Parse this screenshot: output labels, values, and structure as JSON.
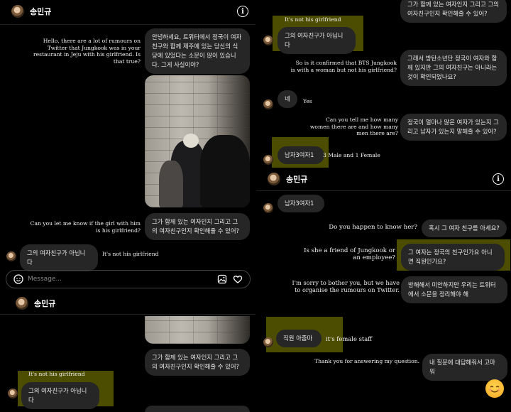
{
  "header": {
    "username": "송민규"
  },
  "left_panel": {
    "messages": [
      {
        "speaker": "sent",
        "korean": "안녕하세요, 트위터에서 정국이 여자친구와 함께 제주에 있는 당신의 식당에 있었다는 소문이 많이 있습니다. 그게 사실이야?",
        "english": "Hello, there are a lot of rumours on Twitter that Jungkook was in your restaurant in Jeju with his girlfriend. Is that true?"
      },
      {
        "speaker": "sent",
        "korean": "그가 함께 있는 여자인지 그리고 그의 여자친구인지 확인해줄 수 있어?",
        "english": "Can you let me know if the girl with him is his girlfriend?"
      },
      {
        "speaker": "received",
        "korean": "그의 여자친구가 아닙니다",
        "english": "It's not his girlfriend"
      }
    ],
    "composer": {
      "placeholder": "Message..."
    }
  },
  "left_panel_bottom": {
    "messages": [
      {
        "speaker": "sent",
        "korean": "그가 함께 있는 여자인지 그리고 그의 여자친구인지 확인해줄 수 있어?"
      },
      {
        "speaker": "received",
        "korean": "그의 여자친구가 아닙니다",
        "english": "It's not his girlfriend"
      }
    ]
  },
  "right_panel_top": {
    "messages": [
      {
        "speaker": "sent",
        "korean": "그가 함께 있는 여자인지 그리고 그의 여자친구인지 확인해줄 수 있어?"
      },
      {
        "speaker": "received",
        "korean": "그의 여자친구가 아닙니다",
        "english": "It's not his girlfriend"
      },
      {
        "speaker": "sent",
        "korean": "그래서 방탄소년단 정국이 여자와 함께 있지만 그의 여자친구는 아니라는 것이 확인되었나요?",
        "english": "So is it confirmed that BTS Jungkook is with a woman but not his girlfriend?"
      },
      {
        "speaker": "received",
        "korean": "네",
        "english": "Yes"
      },
      {
        "speaker": "sent",
        "korean": "정국이 얼마나 많은 여자가 있는지 그리고 남자가 있는지 말해줄 수 있어?",
        "english": "Can you tell me how many women there are and how many men there are?"
      },
      {
        "speaker": "received",
        "korean": "남자3여자1",
        "english": "3 Male and 1 Female"
      }
    ]
  },
  "right_panel_bottom": {
    "messages": [
      {
        "speaker": "received",
        "korean": "남자3여자1"
      },
      {
        "speaker": "sent",
        "korean": "혹시 그 여자 친구를 아세요?",
        "english": "Do you happen to know her?"
      },
      {
        "speaker": "sent",
        "korean": "그 여자는 정국의 친구인가요 아니면 직원인가요?",
        "english": "Is she a friend of Jungkook or an employee?"
      },
      {
        "speaker": "sent",
        "korean": "방해해서 미안하지만 우리는 트위터에서 소문을 정리해야 해",
        "english": "I'm sorry to bother you, but we have to organise the rumours on Twitter."
      },
      {
        "speaker": "received",
        "korean": "직원 아줌마",
        "english": "it's female staff"
      },
      {
        "speaker": "sent",
        "korean": "내 질문에 대답해줘서 고마워",
        "english": "Thank you for answering my question."
      }
    ]
  },
  "colors": {
    "highlight": "#8c8c00",
    "bubble": "#262626",
    "background": "#000000"
  },
  "icons": [
    "info-icon",
    "emoji-icon",
    "gallery-icon",
    "heart-icon",
    "smiling-face-emoji"
  ]
}
